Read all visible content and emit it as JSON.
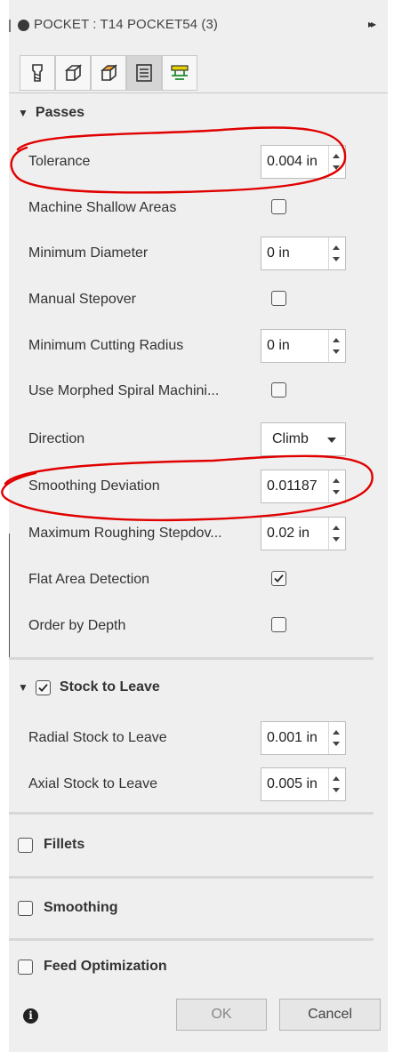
{
  "titlebar": {
    "title": "POCKET : T14 POCKET54 (3)"
  },
  "tabs": [
    {
      "name": "tool",
      "active": false
    },
    {
      "name": "geometry",
      "active": false
    },
    {
      "name": "heights",
      "active": false
    },
    {
      "name": "passes",
      "active": true
    },
    {
      "name": "linking",
      "active": false
    }
  ],
  "passes": {
    "title": "Passes",
    "tolerance": {
      "label": "Tolerance",
      "value": "0.004 in"
    },
    "machine_shallow": {
      "label": "Machine Shallow Areas",
      "checked": false
    },
    "min_diameter": {
      "label": "Minimum Diameter",
      "value": "0 in"
    },
    "manual_stepover": {
      "label": "Manual Stepover",
      "checked": false
    },
    "min_cut_radius": {
      "label": "Minimum Cutting Radius",
      "value": "0 in"
    },
    "morphed_spiral": {
      "label": "Use Morphed Spiral Machini...",
      "checked": false
    },
    "direction": {
      "label": "Direction",
      "value": "Climb"
    },
    "smoothing_dev": {
      "label": "Smoothing Deviation",
      "value": "0.01187"
    },
    "max_rough": {
      "label": "Maximum Roughing Stepdov...",
      "value": "0.02 in"
    },
    "flat_area": {
      "label": "Flat Area Detection",
      "checked": true
    },
    "order_depth": {
      "label": "Order by Depth",
      "checked": false
    }
  },
  "stock": {
    "title": "Stock to Leave",
    "checked": true,
    "radial": {
      "label": "Radial Stock to Leave",
      "value": "0.001 in"
    },
    "axial": {
      "label": "Axial Stock to Leave",
      "value": "0.005 in"
    }
  },
  "fillets": {
    "title": "Fillets",
    "checked": false
  },
  "smoothing": {
    "title": "Smoothing",
    "checked": false
  },
  "feed_opt": {
    "title": "Feed Optimization",
    "checked": false
  },
  "footer": {
    "info": "i",
    "ok": "OK",
    "cancel": "Cancel"
  },
  "colors": {
    "panel_bg": "#efefef",
    "annotation_red": "#e00000"
  }
}
